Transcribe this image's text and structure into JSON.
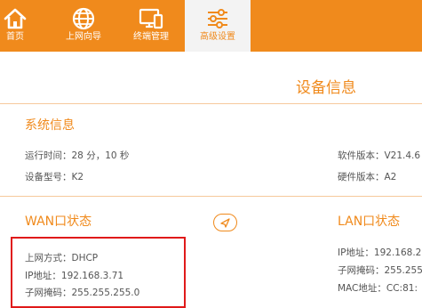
{
  "nav": {
    "items": [
      {
        "label": "首页",
        "icon": "home-icon"
      },
      {
        "label": "上网向导",
        "icon": "globe-icon"
      },
      {
        "label": "终端管理",
        "icon": "devices-icon"
      },
      {
        "label": "高级设置",
        "icon": "sliders-icon"
      }
    ],
    "active_index": 3
  },
  "page": {
    "title": "设备信息"
  },
  "system_info": {
    "title": "系统信息",
    "uptime": "运行时间：28 分，10 秒",
    "model": "设备型号：K2",
    "software_version": "软件版本：V21.4.6",
    "hardware_version": "硬件版本：A2"
  },
  "wan": {
    "title": "WAN口状态",
    "connection_type": "上网方式：DHCP",
    "ip": "IP地址：192.168.3.71",
    "subnet": "子网掩码：255.255.255.0"
  },
  "lan": {
    "title": "LAN口状态",
    "ip": "IP地址：192.168.2",
    "subnet": "子网掩码：255.255",
    "mac": "MAC地址：CC:81:"
  },
  "colors": {
    "accent": "#f08a1c",
    "highlight_border": "#e01a1a",
    "text": "#555555"
  }
}
